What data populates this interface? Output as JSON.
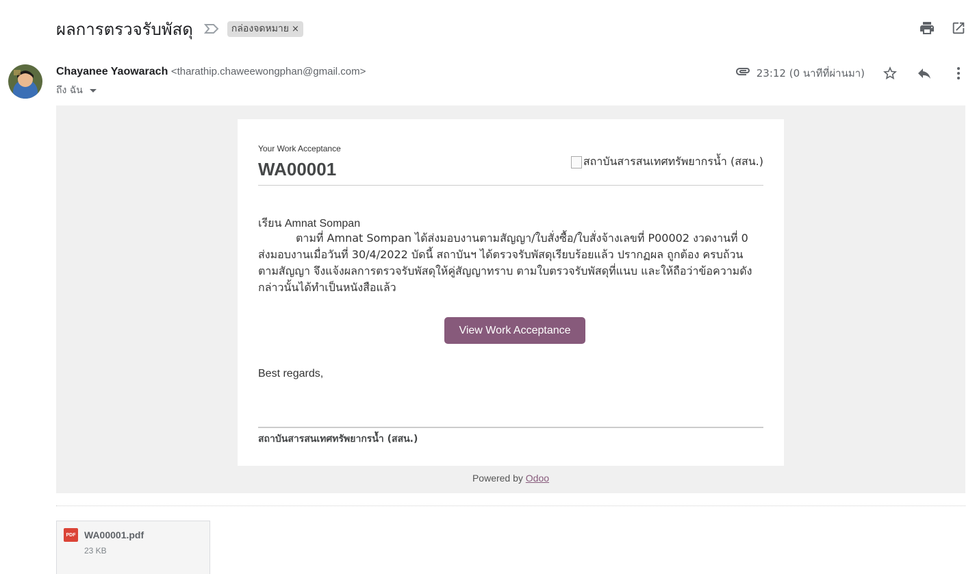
{
  "subject": {
    "title": "ผลการตรวจรับพัสดุ",
    "label": "กล่องจดหมาย",
    "label_remove": "×"
  },
  "toolbar": {
    "print_icon": "print-icon",
    "open_new_window_icon": "open-in-new-icon"
  },
  "sender": {
    "name": "Chayanee Yaowarach",
    "email": "<tharathip.chaweewongphan@gmail.com>",
    "to": "ถึง ฉัน",
    "time": "23:12 (0 นาทีที่ผ่านมา)"
  },
  "message": {
    "wa_label": "Your Work Acceptance",
    "wa_number": "WA00001",
    "logo_alt": "สถาบันสารสนเทศทรัพยากรน้ำ (สสน.)",
    "greeting": "เรียน Amnat Sompan",
    "paragraph": "ตามที่ Amnat Sompan ได้ส่งมอบงานตามสัญญา/ใบสั่งซื้อ/ใบสั่งจ้างเลขที่ P00002 งวดงานที่ 0 ส่งมอบงานเมื่อวันที่ 30/4/2022 บัดนี้ สถาบันฯ ได้ตรวจรับพัสดุเรียบร้อยแล้ว ปรากฏผล ถูกต้อง ครบถ้วนตามสัญญา จึงแจ้งผลการตรวจรับพัสดุให้คู่สัญญาทราบ ตามใบตรวจรับพัสดุที่แนบ และให้ถือว่าข้อความดังกล่าวนั้นได้ทำเป็นหนังสือแล้ว",
    "button_label": "View Work Acceptance",
    "regards": "Best regards,",
    "org_name": "สถาบันสารสนเทศทรัพยากรน้ำ (สสน.)",
    "powered_by": "Powered by",
    "powered_link": "Odoo"
  },
  "attachment": {
    "badge": "PDF",
    "name": "WA00001.pdf",
    "size": "23 KB"
  },
  "colors": {
    "button": "#875a7b",
    "body_bg": "#f0f0f0",
    "pdf": "#db4437"
  }
}
